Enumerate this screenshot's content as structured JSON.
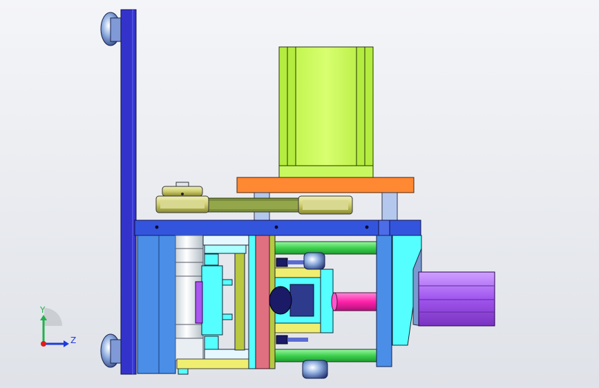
{
  "viewport": {
    "background_top": "#f4f5f8",
    "background_bottom": "#dfe2e8"
  },
  "triad": {
    "y_label": "Y",
    "z_label": "Z",
    "y_color": "#22b14c",
    "z_color": "#1f3bd8",
    "x_color": "#e01c1c"
  },
  "palette": {
    "base_plate": "#3333cc",
    "motor": "#c8ff55",
    "motor_mount": "#ff8833",
    "rail": "#3355dd",
    "belt": "#7a8c3a",
    "pulley": "#d8d890",
    "block": "#4a8ee8",
    "cyan_part": "#55ffff",
    "green_rod": "#44dd55",
    "pink_plate": "#e07080",
    "yellow_plate": "#f0ee70",
    "olive_plate": "#b8c840",
    "magenta_rod": "#ff22aa",
    "purple_cylinder": "#aa55ee",
    "navy_hub": "#1a1a66",
    "steel_part": "#b4c0ce",
    "light_part": "#e8eef2"
  }
}
